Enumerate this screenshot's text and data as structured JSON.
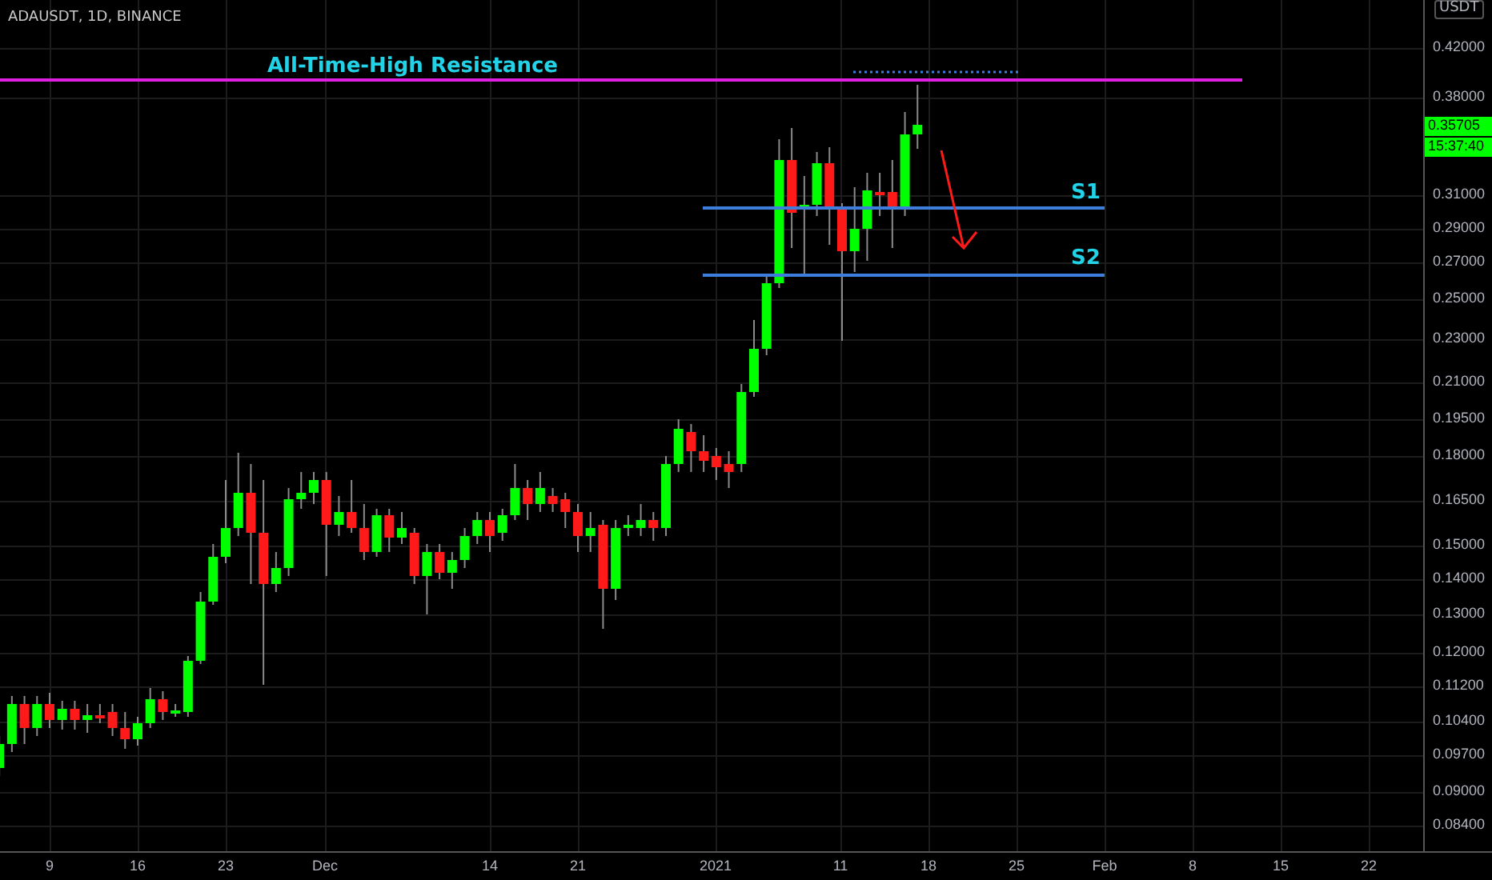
{
  "symbol_title": "ADAUSDT, 1D, BINANCE",
  "levels": [
    {
      "label": "All-Time-High Resistance",
      "color": "#e020e0"
    },
    {
      "label": "S1",
      "color": "#3d7ddb"
    },
    {
      "label": "S2",
      "color": "#3d7ddb"
    }
  ],
  "price_axis": {
    "currency": "USDT",
    "ticks": [
      "0.42000",
      "0.38000",
      "0.31000",
      "0.29000",
      "0.27000",
      "0.25000",
      "0.23000",
      "0.21000",
      "0.19500",
      "0.18000",
      "0.16500",
      "0.15000",
      "0.14000",
      "0.13000",
      "0.12000",
      "0.11200",
      "0.10400",
      "0.09700",
      "0.09000",
      "0.08400"
    ],
    "last_price": "0.35705",
    "countdown": "15:37:40"
  },
  "time_axis": {
    "ticks": [
      "9",
      "16",
      "23",
      "Dec",
      "14",
      "21",
      "2021",
      "11",
      "18",
      "25",
      "Feb",
      "8",
      "15",
      "22"
    ]
  }
}
